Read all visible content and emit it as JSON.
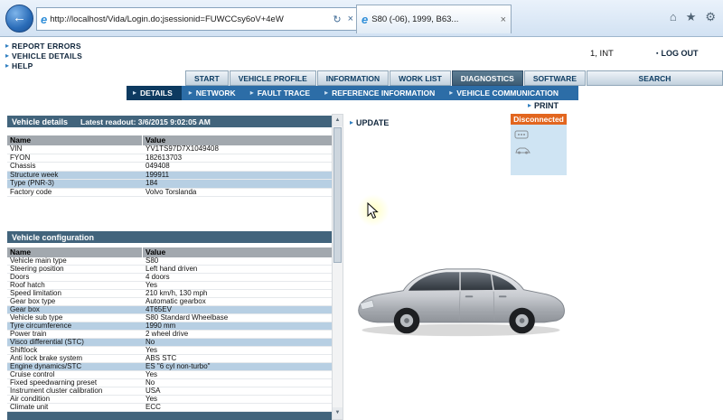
{
  "browser": {
    "url": "http://localhost/Vida/Login.do;jsessionid=FUWCCsy6oV+4eW",
    "tab_title": "S80 (-06), 1999, B63..."
  },
  "icons": {
    "back": "←",
    "refresh": "↻",
    "stop": "×",
    "close": "×",
    "home": "⌂",
    "favorites": "★",
    "tools": "⚙",
    "arrow": "▸",
    "bullet": "▪",
    "up": "▲",
    "down": "▼",
    "ie": "e"
  },
  "header": {
    "links": [
      {
        "label": "REPORT ERRORS"
      },
      {
        "label": "VEHICLE DETAILS"
      },
      {
        "label": "HELP"
      }
    ],
    "session": "1, INT",
    "logout": "LOG OUT"
  },
  "tabs": [
    {
      "label": "START",
      "active": false
    },
    {
      "label": "VEHICLE PROFILE",
      "active": false
    },
    {
      "label": "INFORMATION",
      "active": false
    },
    {
      "label": "WORK LIST",
      "active": false
    },
    {
      "label": "DIAGNOSTICS",
      "active": true
    },
    {
      "label": "SOFTWARE",
      "active": false
    },
    {
      "label": "SEARCH",
      "active": false
    }
  ],
  "subnav": {
    "active": "DETAILS",
    "items": [
      {
        "label": "NETWORK"
      },
      {
        "label": "FAULT TRACE"
      },
      {
        "label": "REFERENCE INFORMATION"
      },
      {
        "label": "VEHICLE COMMUNICATION"
      }
    ]
  },
  "actions": {
    "print": "PRINT",
    "update": "UPDATE"
  },
  "connection": {
    "status": "Disconnected"
  },
  "vehicle_details": {
    "title": "Vehicle details",
    "readout_label": "Latest readout: 3/6/2015 9:02:05 AM",
    "columns": [
      "Name",
      "Value"
    ],
    "rows": [
      {
        "name": "VIN",
        "value": "YV1TS97D7X1049408",
        "hl": false
      },
      {
        "name": "FYON",
        "value": "182613703",
        "hl": false
      },
      {
        "name": "Chassis",
        "value": "049408",
        "hl": false
      },
      {
        "name": "Structure week",
        "value": "199911",
        "hl": true
      },
      {
        "name": "Type (PNR-3)",
        "value": "184",
        "hl": true
      },
      {
        "name": "Factory code",
        "value": "Volvo Torslanda",
        "hl": false
      }
    ]
  },
  "vehicle_configuration": {
    "title": "Vehicle configuration",
    "columns": [
      "Name",
      "Value"
    ],
    "rows": [
      {
        "name": "Vehicle main type",
        "value": "S80",
        "hl": false
      },
      {
        "name": "Steering position",
        "value": "Left hand driven",
        "hl": false
      },
      {
        "name": "Doors",
        "value": "4 doors",
        "hl": false
      },
      {
        "name": "Roof hatch",
        "value": "Yes",
        "hl": false
      },
      {
        "name": "Speed limitation",
        "value": "210 km/h, 130 mph",
        "hl": false
      },
      {
        "name": "Gear box type",
        "value": "Automatic gearbox",
        "hl": false
      },
      {
        "name": "Gear box",
        "value": "4T65EV",
        "hl": true
      },
      {
        "name": "Vehicle sub type",
        "value": "S80 Standard Wheelbase",
        "hl": false
      },
      {
        "name": "Tyre circumference",
        "value": "1990 mm",
        "hl": true
      },
      {
        "name": "Power train",
        "value": "2 wheel drive",
        "hl": false
      },
      {
        "name": "Visco differential (STC)",
        "value": "No",
        "hl": true
      },
      {
        "name": "Shiftlock",
        "value": "Yes",
        "hl": false
      },
      {
        "name": "Anti lock brake system",
        "value": "ABS STC",
        "hl": false
      },
      {
        "name": "Engine dynamics/STC",
        "value": "ES \"6 cyl non-turbo\"",
        "hl": true
      },
      {
        "name": "Cruise control",
        "value": "Yes",
        "hl": false
      },
      {
        "name": "Fixed speedwarning preset",
        "value": "No",
        "hl": false
      },
      {
        "name": "Instrument cluster calibration",
        "value": "USA",
        "hl": false
      },
      {
        "name": "Air condition",
        "value": "Yes",
        "hl": false
      },
      {
        "name": "Climate unit",
        "value": "ECC",
        "hl": false
      }
    ]
  }
}
